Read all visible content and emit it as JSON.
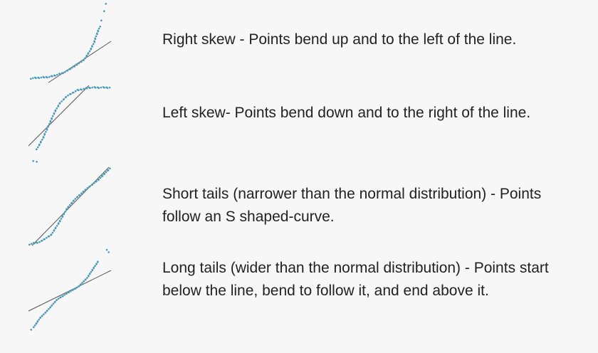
{
  "rows": [
    {
      "kind": "right-skew",
      "text": "Right skew - Points bend up and to the left of the line."
    },
    {
      "kind": "left-skew",
      "text": "Left skew- Points bend down and to the right of the line."
    },
    {
      "kind": "short-tails",
      "text": "Short tails (narrower than the normal distribution) - Points follow an S shaped-curve."
    },
    {
      "kind": "long-tails",
      "text": "Long tails (wider than the normal distribution) - Points start below the line, bend to follow it, and end above it."
    }
  ],
  "colors": {
    "points": "#4a9ab8",
    "reference_line": "#555555",
    "text": "#222222",
    "background": "#f7f7f7"
  }
}
